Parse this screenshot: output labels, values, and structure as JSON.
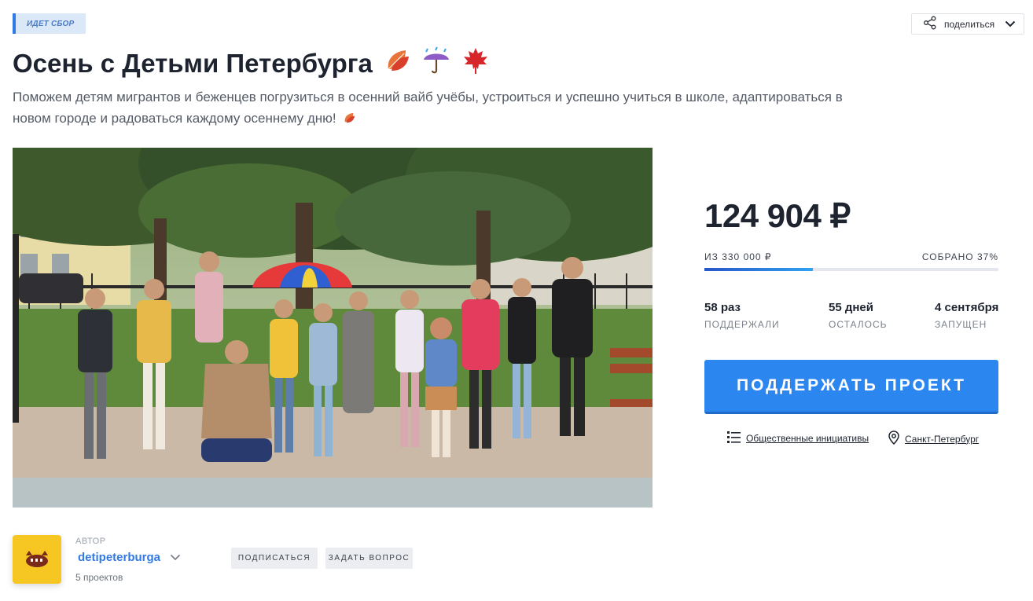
{
  "status_badge": "ИДЕТ СБОР",
  "share": {
    "label": "поделиться"
  },
  "title": "Осень с Детьми Петербурга",
  "description": "Поможем детям мигрантов и беженцев погрузиться в осенний вайб учёбы, устроиться и успешно учиться в школе, адаптироваться в новом городе и радоваться каждому осеннему дню!",
  "funding": {
    "raised": "124 904 ₽",
    "goal_text": "ИЗ 330 000 ₽",
    "percent_text": "СОБРАНО 37%",
    "progress_fraction": 0.37
  },
  "stats": [
    {
      "value": "58 раз",
      "label": "ПОДДЕРЖАЛИ"
    },
    {
      "value": "55 дней",
      "label": "ОСТАЛОСЬ"
    },
    {
      "value": "4 сентября",
      "label": "ЗАПУЩЕН"
    }
  ],
  "support_button": "ПОДДЕРЖАТЬ ПРОЕКТ",
  "category": "Общественные инициативы",
  "location": "Санкт-Петербург",
  "author": {
    "caption": "АВТОР",
    "name": "detipeterburga",
    "projects": "5 проектов"
  },
  "buttons": {
    "subscribe": "ПОДПИСАТЬСЯ",
    "ask": "ЗАДАТЬ ВОПРОС"
  },
  "colors": {
    "accent": "#2c86f0",
    "author_link": "#2f7ae5",
    "badge_bg": "#dbe8f8",
    "progress_start": "#2755c9",
    "progress_end": "#2fa3f2"
  }
}
